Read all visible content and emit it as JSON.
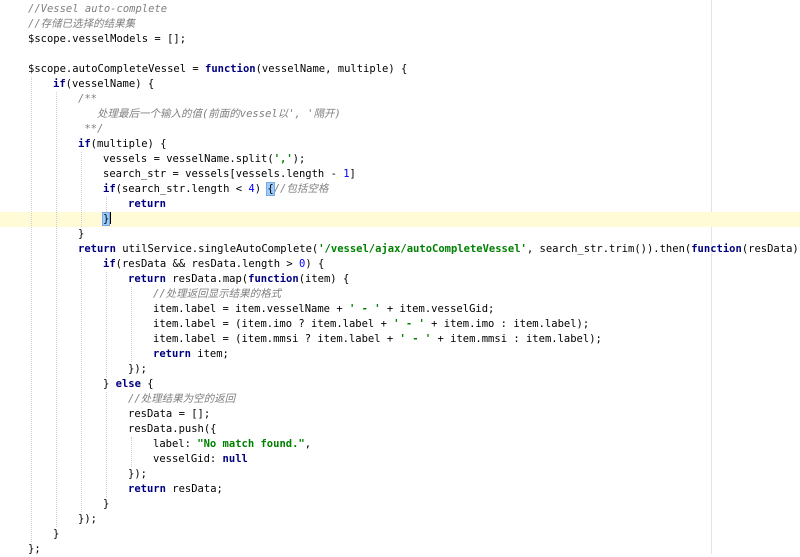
{
  "editor": {
    "caret_line": 14,
    "lines": [
      {
        "indent": 0,
        "tokens": [
          {
            "t": "//Vessel auto-complete",
            "k": "comment"
          }
        ]
      },
      {
        "indent": 0,
        "tokens": [
          {
            "t": "//存储已选择的结果集",
            "k": "comment"
          }
        ]
      },
      {
        "indent": 0,
        "tokens": [
          {
            "t": "$scope.vesselModels = [];",
            "k": "plain"
          }
        ]
      },
      {
        "indent": 0,
        "tokens": []
      },
      {
        "indent": 0,
        "tokens": [
          {
            "t": "$scope.autoCompleteVessel = ",
            "k": "plain"
          },
          {
            "t": "function",
            "k": "keyword"
          },
          {
            "t": "(vesselName, multiple) {",
            "k": "plain"
          }
        ]
      },
      {
        "indent": 1,
        "tokens": [
          {
            "t": "if",
            "k": "keyword"
          },
          {
            "t": "(vesselName) {",
            "k": "plain"
          }
        ]
      },
      {
        "indent": 2,
        "tokens": [
          {
            "t": "/**",
            "k": "comment"
          }
        ]
      },
      {
        "indent": 2,
        "tokens": [
          {
            "t": "   处理最后一个输入的值(前面的vessel以', '隔开)",
            "k": "comment"
          }
        ]
      },
      {
        "indent": 2,
        "tokens": [
          {
            "t": " **/",
            "k": "comment"
          }
        ]
      },
      {
        "indent": 2,
        "tokens": [
          {
            "t": "if",
            "k": "keyword"
          },
          {
            "t": "(multiple) {",
            "k": "plain"
          }
        ]
      },
      {
        "indent": 3,
        "tokens": [
          {
            "t": "vessels = vesselName.split(",
            "k": "plain"
          },
          {
            "t": "','",
            "k": "string"
          },
          {
            "t": ");",
            "k": "plain"
          }
        ]
      },
      {
        "indent": 3,
        "tokens": [
          {
            "t": "search_str = vessels[vessels.length - ",
            "k": "plain"
          },
          {
            "t": "1",
            "k": "number"
          },
          {
            "t": "]",
            "k": "plain"
          }
        ]
      },
      {
        "indent": 3,
        "tokens": [
          {
            "t": "if",
            "k": "keyword"
          },
          {
            "t": "(search_str.length < ",
            "k": "plain"
          },
          {
            "t": "4",
            "k": "number"
          },
          {
            "t": ") ",
            "k": "plain"
          },
          {
            "t": "{",
            "k": "bracket"
          },
          {
            "t": "//包括空格",
            "k": "comment"
          }
        ]
      },
      {
        "indent": 4,
        "tokens": [
          {
            "t": "return",
            "k": "keyword"
          }
        ]
      },
      {
        "indent": 3,
        "tokens": [
          {
            "t": "}",
            "k": "bracket"
          },
          {
            "t": "",
            "k": "caret"
          }
        ]
      },
      {
        "indent": 2,
        "tokens": [
          {
            "t": "}",
            "k": "plain"
          }
        ]
      },
      {
        "indent": 2,
        "tokens": [
          {
            "t": "return",
            "k": "keyword"
          },
          {
            "t": " utilService.singleAutoComplete(",
            "k": "plain"
          },
          {
            "t": "'/vessel/ajax/autoCompleteVessel'",
            "k": "string"
          },
          {
            "t": ", search_str.trim()).then(",
            "k": "plain"
          },
          {
            "t": "function",
            "k": "keyword"
          },
          {
            "t": "(resData) {",
            "k": "plain"
          }
        ]
      },
      {
        "indent": 3,
        "tokens": [
          {
            "t": "if",
            "k": "keyword"
          },
          {
            "t": "(resData && resData.length > ",
            "k": "plain"
          },
          {
            "t": "0",
            "k": "number"
          },
          {
            "t": ") {",
            "k": "plain"
          }
        ]
      },
      {
        "indent": 4,
        "tokens": [
          {
            "t": "return",
            "k": "keyword"
          },
          {
            "t": " resData.map(",
            "k": "plain"
          },
          {
            "t": "function",
            "k": "keyword"
          },
          {
            "t": "(item) {",
            "k": "plain"
          }
        ]
      },
      {
        "indent": 5,
        "tokens": [
          {
            "t": "//处理返回显示结果的格式",
            "k": "comment"
          }
        ]
      },
      {
        "indent": 5,
        "tokens": [
          {
            "t": "item.label = item.vesselName + ",
            "k": "plain"
          },
          {
            "t": "' - '",
            "k": "string"
          },
          {
            "t": " + item.vesselGid;",
            "k": "plain"
          }
        ]
      },
      {
        "indent": 5,
        "tokens": [
          {
            "t": "item.label = (item.imo ? item.label + ",
            "k": "plain"
          },
          {
            "t": "' - '",
            "k": "string"
          },
          {
            "t": " + item.imo : item.label);",
            "k": "plain"
          }
        ]
      },
      {
        "indent": 5,
        "tokens": [
          {
            "t": "item.label = (item.mmsi ? item.label + ",
            "k": "plain"
          },
          {
            "t": "' - '",
            "k": "string"
          },
          {
            "t": " + item.mmsi : item.label);",
            "k": "plain"
          }
        ]
      },
      {
        "indent": 5,
        "tokens": [
          {
            "t": "return",
            "k": "keyword"
          },
          {
            "t": " item;",
            "k": "plain"
          }
        ]
      },
      {
        "indent": 4,
        "tokens": [
          {
            "t": "});",
            "k": "plain"
          }
        ]
      },
      {
        "indent": 3,
        "tokens": [
          {
            "t": "} ",
            "k": "plain"
          },
          {
            "t": "else",
            "k": "keyword"
          },
          {
            "t": " {",
            "k": "plain"
          }
        ]
      },
      {
        "indent": 4,
        "tokens": [
          {
            "t": "//处理结果为空的返回",
            "k": "comment"
          }
        ]
      },
      {
        "indent": 4,
        "tokens": [
          {
            "t": "resData = [];",
            "k": "plain"
          }
        ]
      },
      {
        "indent": 4,
        "tokens": [
          {
            "t": "resData.push({",
            "k": "plain"
          }
        ]
      },
      {
        "indent": 5,
        "tokens": [
          {
            "t": "label: ",
            "k": "plain"
          },
          {
            "t": "\"No match found.\"",
            "k": "string"
          },
          {
            "t": ",",
            "k": "plain"
          }
        ]
      },
      {
        "indent": 5,
        "tokens": [
          {
            "t": "vesselGid: ",
            "k": "plain"
          },
          {
            "t": "null",
            "k": "keyword"
          }
        ]
      },
      {
        "indent": 4,
        "tokens": [
          {
            "t": "});",
            "k": "plain"
          }
        ]
      },
      {
        "indent": 4,
        "tokens": [
          {
            "t": "return",
            "k": "keyword"
          },
          {
            "t": " resData;",
            "k": "plain"
          }
        ]
      },
      {
        "indent": 3,
        "tokens": [
          {
            "t": "}",
            "k": "plain"
          }
        ]
      },
      {
        "indent": 2,
        "tokens": [
          {
            "t": "});",
            "k": "plain"
          }
        ]
      },
      {
        "indent": 1,
        "tokens": [
          {
            "t": "}",
            "k": "plain"
          }
        ]
      },
      {
        "indent": 0,
        "tokens": [
          {
            "t": "};",
            "k": "plain"
          }
        ]
      }
    ]
  }
}
